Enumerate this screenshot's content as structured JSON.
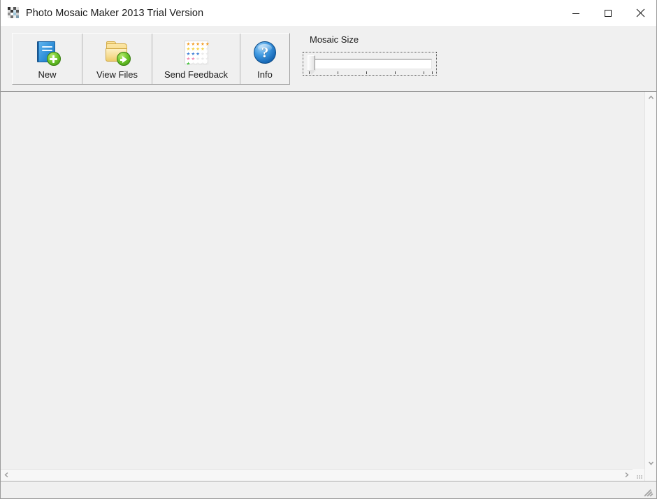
{
  "window": {
    "title": "Photo Mosaic Maker 2013 Trial Version",
    "icon_name": "mosaic-app-icon",
    "controls": {
      "minimize_label": "Minimize",
      "maximize_label": "Maximize",
      "close_label": "Close"
    }
  },
  "toolbar": {
    "buttons": [
      {
        "label": "New",
        "icon": "new-document-book-plus-icon"
      },
      {
        "label": "View Files",
        "icon": "folder-arrow-icon"
      },
      {
        "label": "Send Feedback",
        "icon": "star-rating-grid-icon"
      },
      {
        "label": "Info",
        "icon": "question-mark-circle-icon"
      }
    ]
  },
  "mosaic_size": {
    "label": "Mosaic Size",
    "control": "trackbar-slider",
    "value": 0,
    "min": 0,
    "max": 100,
    "tick_count": 5,
    "thumb_position_percent": 0
  },
  "canvas": {
    "content": "",
    "background_color": "#f0f0f0"
  },
  "scrollbars": {
    "vertical": {
      "up_arrow": "chevron-up-icon",
      "down_arrow": "chevron-down-icon"
    },
    "horizontal": {
      "left_arrow": "chevron-left-icon",
      "right_arrow": "chevron-right-icon"
    }
  },
  "statusbar": {
    "text": "",
    "grip": "resize-grip-icon"
  },
  "colors": {
    "window_bg": "#f0f0f0",
    "titlebar_bg": "#ffffff",
    "title_text": "#1a1a1a",
    "toolbar_separator": "#828282",
    "accent_blue": "#2f8fd8",
    "accent_green": "#6cc42a",
    "info_blue": "#3d97e0"
  }
}
